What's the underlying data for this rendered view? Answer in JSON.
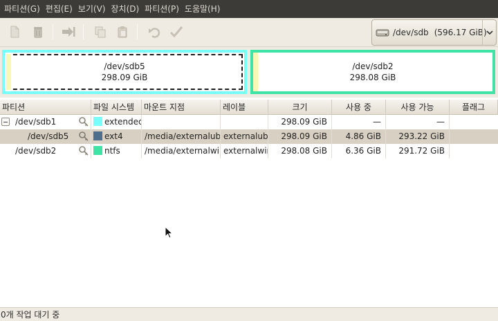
{
  "menubar": {
    "items": [
      "파티션(G)",
      "편집(E)",
      "보기(V)",
      "장치(D)",
      "파티션(P)",
      "도움말(H)"
    ]
  },
  "toolbar": {
    "icons": [
      "new-icon",
      "delete-icon",
      "resize-move-icon",
      "copy-icon",
      "paste-icon",
      "undo-icon",
      "apply-icon"
    ],
    "device": {
      "name": "/dev/sdb",
      "size": "(596.17 GiB)"
    }
  },
  "visual": {
    "partitions": [
      {
        "name": "/dev/sdb5",
        "size": "298.09 GiB",
        "color": "#79fffa"
      },
      {
        "name": "/dev/sdb2",
        "size": "298.08 GiB",
        "color": "#3fe3a5"
      }
    ]
  },
  "table": {
    "columns": [
      "파티션",
      "파일 시스템",
      "마운트 지점",
      "레이블",
      "크기",
      "사용 중",
      "사용 가능",
      "플래그"
    ],
    "rows": [
      {
        "partition": "/dev/sdb1",
        "filesystem": "extended",
        "fs_color": "#79fffa",
        "mount": "",
        "label": "",
        "size": "298.09 GiB",
        "used": "—",
        "unused": "—",
        "flags": ""
      },
      {
        "partition": "/dev/sdb5",
        "filesystem": "ext4",
        "fs_color": "#4e6e8e",
        "mount": "/media/externalubh",
        "label": "externalubh",
        "size": "298.09 GiB",
        "used": "4.86 GiB",
        "unused": "293.22 GiB",
        "flags": ""
      },
      {
        "partition": "/dev/sdb2",
        "filesystem": "ntfs",
        "fs_color": "#3fe3a5",
        "mount": "/media/externalwin",
        "label": "externalwin",
        "size": "298.08 GiB",
        "used": "6.36 GiB",
        "unused": "291.72 GiB",
        "flags": ""
      }
    ]
  },
  "status": {
    "text": "0개 작업 대기 중"
  },
  "colors": {
    "menubar": "#3c3b37",
    "selection": "#d8d0c2"
  }
}
